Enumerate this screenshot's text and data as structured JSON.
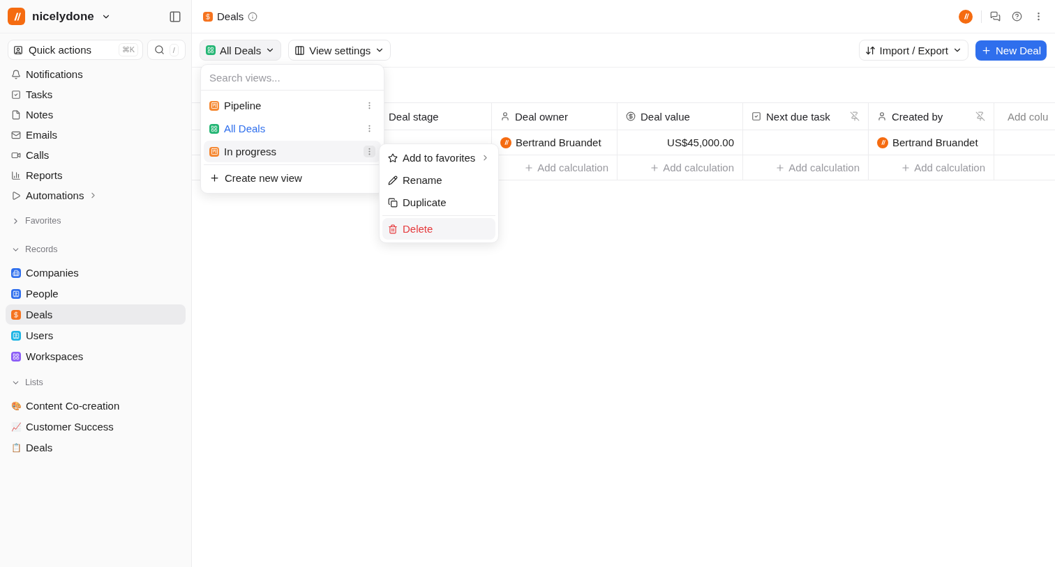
{
  "workspace": {
    "name": "nicelydone"
  },
  "quick_actions": {
    "label": "Quick actions",
    "shortcut": "⌘K",
    "search_shortcut": "/"
  },
  "nav": [
    {
      "label": "Notifications",
      "submenu": false
    },
    {
      "label": "Tasks",
      "submenu": false
    },
    {
      "label": "Notes",
      "submenu": false
    },
    {
      "label": "Emails",
      "submenu": false
    },
    {
      "label": "Calls",
      "submenu": false
    },
    {
      "label": "Reports",
      "submenu": false
    },
    {
      "label": "Automations",
      "submenu": true
    }
  ],
  "sections": [
    {
      "title": "Favorites",
      "expanded": false
    },
    {
      "title": "Records",
      "expanded": true,
      "items": [
        {
          "label": "Companies",
          "color": "#2f6fed",
          "selected": false
        },
        {
          "label": "People",
          "color": "#2f6fed",
          "selected": false
        },
        {
          "label": "Deals",
          "color": "#f5731f",
          "selected": true
        },
        {
          "label": "Users",
          "color": "#1cb4e4",
          "selected": false
        },
        {
          "label": "Workspaces",
          "color": "#8b5cf6",
          "selected": false
        }
      ]
    },
    {
      "title": "Lists",
      "expanded": true,
      "items": [
        {
          "label": "Content Co-creation",
          "emoji": "🎨",
          "selected": false
        },
        {
          "label": "Customer Success",
          "emoji": "📈",
          "selected": false
        },
        {
          "label": "Deals",
          "emoji": "📋",
          "selected": false
        }
      ]
    }
  ],
  "header": {
    "title": "Deals"
  },
  "toolbar": {
    "view": "All Deals",
    "view_settings": "View settings",
    "import_export": "Import / Export",
    "new": "New Deal"
  },
  "view_menu": {
    "placeholder": "Search views...",
    "views": [
      {
        "label": "Pipeline",
        "kind": "kanban",
        "selected": false,
        "hovered": false
      },
      {
        "label": "All Deals",
        "kind": "table",
        "selected": true,
        "hovered": false
      },
      {
        "label": "In progress",
        "kind": "kanban",
        "selected": false,
        "hovered": true
      }
    ],
    "create": "Create new view"
  },
  "context_menu": [
    {
      "label": "Add to favorites",
      "kind": "star",
      "danger": false,
      "submenu": true
    },
    {
      "label": "Rename",
      "kind": "pencil",
      "danger": false,
      "submenu": false
    },
    {
      "label": "Duplicate",
      "kind": "copy",
      "danger": false,
      "submenu": false
    },
    {
      "label": "Delete",
      "kind": "trash",
      "danger": true,
      "submenu": false
    }
  ],
  "table": {
    "columns": [
      {
        "label": "Deal stage",
        "kind": "text",
        "pinnable": false
      },
      {
        "label": "Deal owner",
        "kind": "user",
        "pinnable": false
      },
      {
        "label": "Deal value",
        "kind": "money",
        "pinnable": false
      },
      {
        "label": "Next due task",
        "kind": "task",
        "pinnable": true
      },
      {
        "label": "Created by",
        "kind": "user",
        "pinnable": true
      }
    ],
    "add_column": "Add colu",
    "rows": [
      {
        "deal_owner": "Bertrand Bruandet",
        "deal_value": "US$45,000.00",
        "created_by": "Bertrand Bruandet"
      }
    ],
    "calc": [
      "Add calculation",
      "Add calculation",
      "Add calculation",
      "Add calculation"
    ]
  }
}
